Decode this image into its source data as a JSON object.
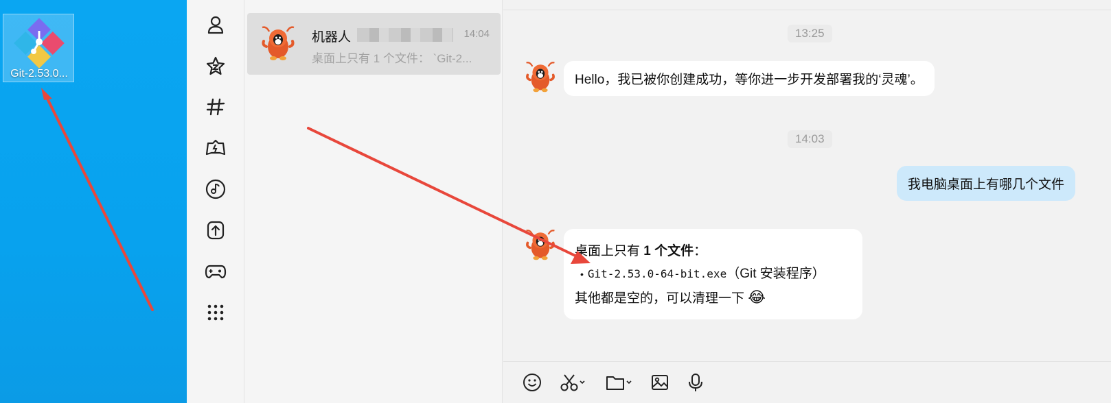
{
  "desktop": {
    "icon_label": "Git-2.53.0...",
    "icon_name": "git-installer-icon"
  },
  "nav_rail": {
    "icons": [
      "person-icon",
      "star-icon",
      "hashtag-icon",
      "game-controller-icon",
      "music-disc-icon",
      "upload-icon",
      "gamepad-icon",
      "more-apps-icon"
    ]
  },
  "chat_list": {
    "item": {
      "name": "机器人",
      "time": "14:04",
      "preview": "桌面上只有 1 个文件： `Git-2..."
    }
  },
  "conversation": {
    "time_1": "13:25",
    "message_1": "Hello，我已被你创建成功，等你进一步开发部署我的‘灵魂’。",
    "time_2": "14:03",
    "user_message": "我电脑桌面上有哪几个文件",
    "message_3": {
      "line1_prefix": "桌面上只有 ",
      "line1_bold": "1 个文件",
      "line1_suffix": "：",
      "bullet": "•",
      "file": "Git-2.53.0-64-bit.exe",
      "file_note": "（Git 安装程序）",
      "line3": "其他都是空的，可以清理一下",
      "emoji": "😂"
    }
  },
  "input_bar": {
    "tools": [
      "emoji-icon",
      "scissors-icon",
      "folder-icon",
      "image-icon",
      "microphone-icon"
    ]
  },
  "colors": {
    "desktop_blue": "#0aa6f2",
    "user_bubble": "#cde9fb",
    "arrow_red": "#e8473b",
    "mascot_orange": "#e45a2a"
  }
}
